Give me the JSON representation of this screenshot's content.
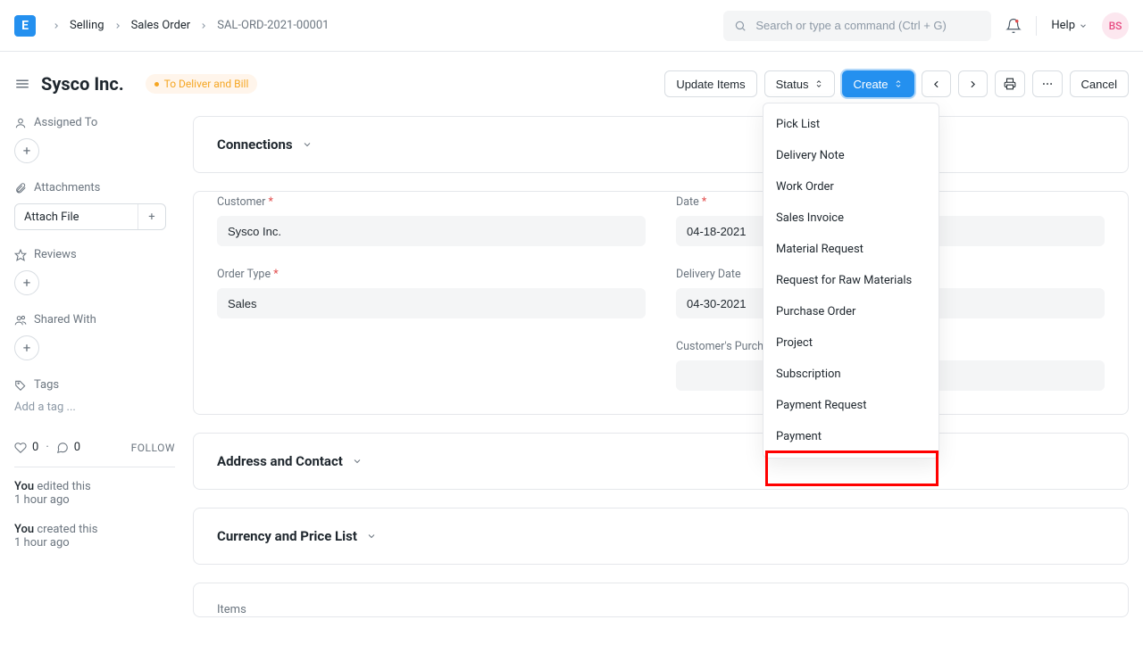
{
  "logo_letter": "E",
  "breadcrumb": {
    "items": [
      "Selling",
      "Sales Order"
    ],
    "current": "SAL-ORD-2021-00001"
  },
  "search": {
    "placeholder": "Search or type a command (Ctrl + G)"
  },
  "help_label": "Help",
  "avatar_initials": "BS",
  "page": {
    "title": "Sysco Inc.",
    "status": "To Deliver and Bill",
    "buttons": {
      "update_items": "Update Items",
      "status": "Status",
      "create": "Create",
      "cancel": "Cancel"
    }
  },
  "sidebar": {
    "assigned_to": "Assigned To",
    "attachments": "Attachments",
    "attach_file": "Attach File",
    "reviews": "Reviews",
    "shared_with": "Shared With",
    "tags": "Tags",
    "add_tag": "Add a tag ...",
    "likes": "0",
    "comments": "0",
    "follow": "FOLLOW",
    "activity": [
      {
        "who": "You",
        "action": "edited this",
        "time": "1 hour ago"
      },
      {
        "who": "You",
        "action": "created this",
        "time": "1 hour ago"
      }
    ]
  },
  "sections": {
    "connections": "Connections",
    "address": "Address and Contact",
    "currency": "Currency and Price List",
    "items": "Items"
  },
  "form": {
    "customer_label": "Customer",
    "customer_value": "Sysco Inc.",
    "order_type_label": "Order Type",
    "order_type_value": "Sales",
    "date_label": "Date",
    "date_value": "04-18-2021",
    "delivery_date_label": "Delivery Date",
    "delivery_date_value": "04-30-2021",
    "cpo_label": "Customer's Purchase Order",
    "cpo_value": ""
  },
  "create_menu": [
    "Pick List",
    "Delivery Note",
    "Work Order",
    "Sales Invoice",
    "Material Request",
    "Request for Raw Materials",
    "Purchase Order",
    "Project",
    "Subscription",
    "Payment Request",
    "Payment"
  ]
}
